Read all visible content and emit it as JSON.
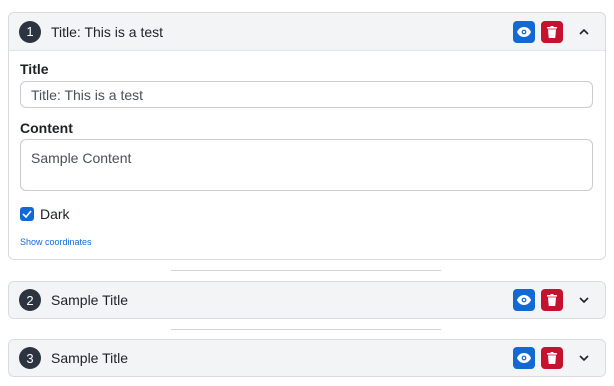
{
  "items": [
    {
      "number": "1",
      "title": "Title: This is a test",
      "expanded": true,
      "chevron": "chevron-up-icon",
      "form": {
        "title_label": "Title",
        "title_value": "Title: This is a test",
        "content_label": "Content",
        "content_value": "Sample Content",
        "dark_label": "Dark",
        "dark_checked": true,
        "coords_link": "Show coordinates"
      }
    },
    {
      "number": "2",
      "title": "Sample Title",
      "expanded": false,
      "chevron": "chevron-down-icon"
    },
    {
      "number": "3",
      "title": "Sample Title",
      "expanded": false,
      "chevron": "chevron-down-icon"
    }
  ],
  "icons": {
    "view": "eye-icon",
    "delete": "trash-icon"
  },
  "colors": {
    "view_button": "#1269d3",
    "delete_button": "#c4122f",
    "badge": "#2c3440",
    "header_bg": "#f3f4f6",
    "link": "#1269d3"
  }
}
